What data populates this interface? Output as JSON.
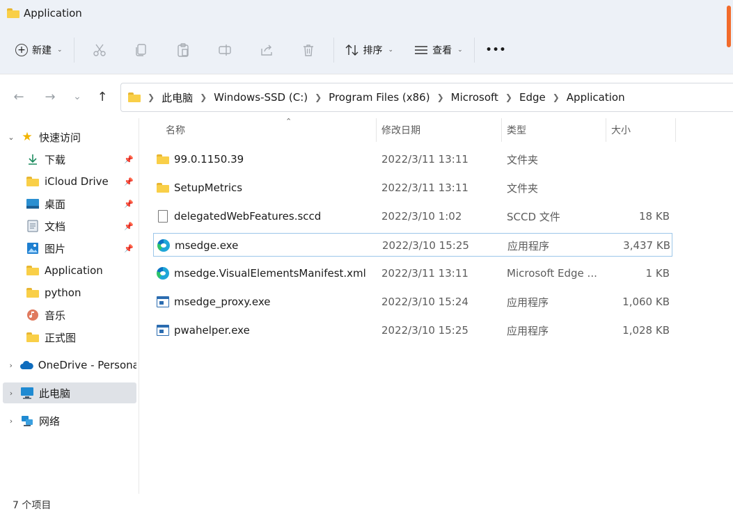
{
  "window": {
    "title": "Application",
    "title_icon": "folder-icon"
  },
  "toolbar": {
    "new_label": "新建",
    "sort_label": "排序",
    "view_label": "查看",
    "more_label": "•••",
    "icons": [
      "cut-icon",
      "copy-icon",
      "paste-icon",
      "rename-icon",
      "share-icon",
      "delete-icon"
    ]
  },
  "nav": {
    "back": "←",
    "forward": "→",
    "recent": "⌄",
    "up": "↑"
  },
  "breadcrumb": [
    "此电脑",
    "Windows-SSD (C:)",
    "Program Files (x86)",
    "Microsoft",
    "Edge",
    "Application"
  ],
  "sidebar": {
    "quick_access": "快速访问",
    "items": [
      {
        "label": "下载",
        "icon": "download-icon",
        "pinned": true
      },
      {
        "label": "iCloud Drive",
        "icon": "folder-icon",
        "pinned": true
      },
      {
        "label": "桌面",
        "icon": "desktop-icon",
        "pinned": true
      },
      {
        "label": "文档",
        "icon": "documents-icon",
        "pinned": true
      },
      {
        "label": "图片",
        "icon": "pictures-icon",
        "pinned": true
      },
      {
        "label": "Application",
        "icon": "folder-icon",
        "pinned": false
      },
      {
        "label": "python",
        "icon": "folder-icon",
        "pinned": false
      },
      {
        "label": "音乐",
        "icon": "music-icon",
        "pinned": false
      },
      {
        "label": "正式图",
        "icon": "folder-icon",
        "pinned": false
      }
    ],
    "onedrive": "OneDrive - Persona",
    "this_pc": "此电脑",
    "network": "网络"
  },
  "columns": {
    "name": "名称",
    "date": "修改日期",
    "type": "类型",
    "size": "大小"
  },
  "files": [
    {
      "name": "99.0.1150.39",
      "date": "2022/3/11 13:11",
      "type": "文件夹",
      "size": "",
      "icon": "folder-icon"
    },
    {
      "name": "SetupMetrics",
      "date": "2022/3/11 13:11",
      "type": "文件夹",
      "size": "",
      "icon": "folder-icon"
    },
    {
      "name": "delegatedWebFeatures.sccd",
      "date": "2022/3/10 1:02",
      "type": "SCCD 文件",
      "size": "18 KB",
      "icon": "document-icon"
    },
    {
      "name": "msedge.exe",
      "date": "2022/3/10 15:25",
      "type": "应用程序",
      "size": "3,437 KB",
      "icon": "edge-icon"
    },
    {
      "name": "msedge.VisualElementsManifest.xml",
      "date": "2022/3/11 13:11",
      "type": "Microsoft Edge ...",
      "size": "1 KB",
      "icon": "edge-icon"
    },
    {
      "name": "msedge_proxy.exe",
      "date": "2022/3/10 15:24",
      "type": "应用程序",
      "size": "1,060 KB",
      "icon": "exe-icon"
    },
    {
      "name": "pwahelper.exe",
      "date": "2022/3/10 15:25",
      "type": "应用程序",
      "size": "1,028 KB",
      "icon": "exe-icon"
    }
  ],
  "status": {
    "item_count": "7 个项目"
  }
}
